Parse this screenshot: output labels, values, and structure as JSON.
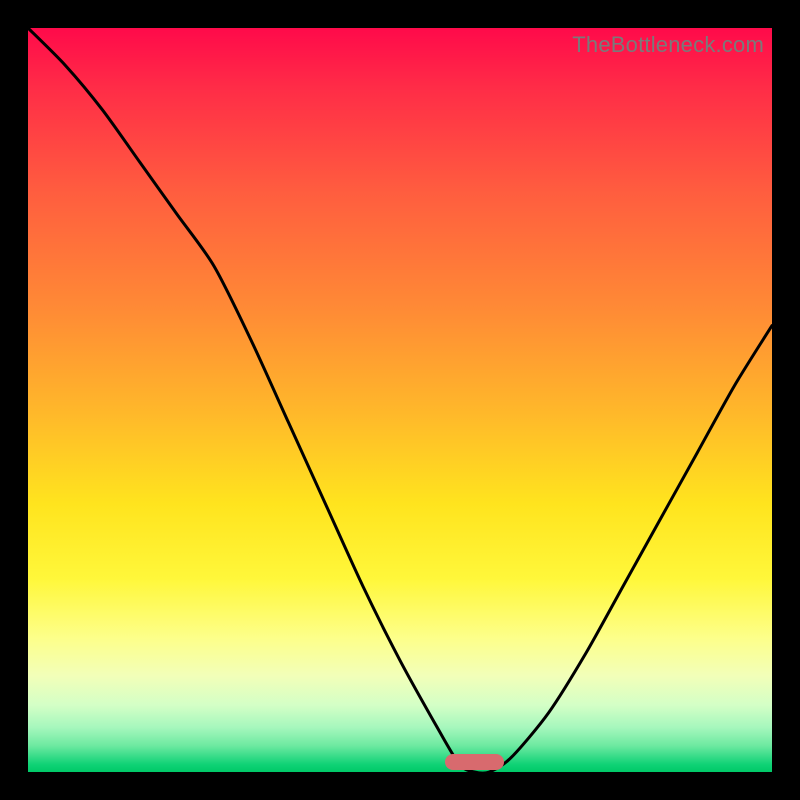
{
  "watermark": "TheBottleneck.com",
  "colors": {
    "frame": "#000000",
    "curve": "#000000",
    "pill": "#d86a6e",
    "watermark": "#7a7a7a"
  },
  "chart_data": {
    "type": "line",
    "title": "",
    "xlabel": "",
    "ylabel": "",
    "xlim": [
      0,
      100
    ],
    "ylim": [
      0,
      100
    ],
    "grid": false,
    "series": [
      {
        "name": "bottleneck-curve",
        "x": [
          0,
          5,
          10,
          15,
          20,
          25,
          30,
          35,
          40,
          45,
          50,
          55,
          58,
          60,
          62,
          65,
          70,
          75,
          80,
          85,
          90,
          95,
          100
        ],
        "values": [
          100,
          95,
          89,
          82,
          75,
          68,
          58,
          47,
          36,
          25,
          15,
          6,
          1,
          0,
          0,
          2,
          8,
          16,
          25,
          34,
          43,
          52,
          60
        ]
      }
    ],
    "marker": {
      "name": "optimal-range-pill",
      "x_start": 56,
      "x_end": 64,
      "y": 0
    },
    "background_gradient_stops": [
      {
        "pos": 0.0,
        "color": "#ff0a4a"
      },
      {
        "pos": 0.22,
        "color": "#ff5d3f"
      },
      {
        "pos": 0.52,
        "color": "#ffb92a"
      },
      {
        "pos": 0.74,
        "color": "#fff73a"
      },
      {
        "pos": 0.91,
        "color": "#d4ffc6"
      },
      {
        "pos": 1.0,
        "color": "#00c968"
      }
    ]
  }
}
